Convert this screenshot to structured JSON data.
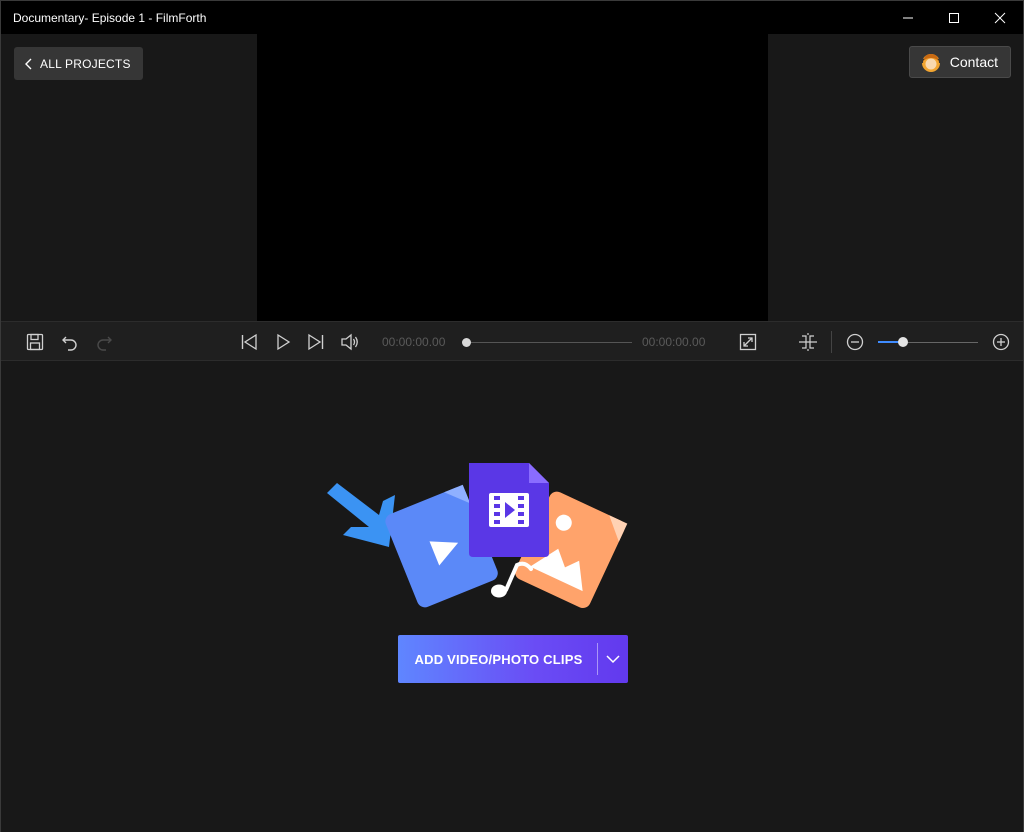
{
  "window": {
    "title": "Documentary- Episode 1 - FilmForth"
  },
  "header": {
    "back_label": "ALL PROJECTS",
    "contact_label": "Contact"
  },
  "player": {
    "current_time": "00:00:00.00",
    "total_time": "00:00:00.00",
    "seek_progress": 0.0,
    "zoom_level": 0.25
  },
  "timeline": {
    "add_clips_label": "ADD VIDEO/PHOTO CLIPS"
  },
  "colors": {
    "accent": "#5f86ff",
    "button_gradient_end": "#6239ee",
    "video_card": "#5b89f8",
    "film_card": "#5a37e6",
    "photo_card": "#ffa36b",
    "arrow": "#3b93f3",
    "zoom_fill": "#3f8cff"
  }
}
